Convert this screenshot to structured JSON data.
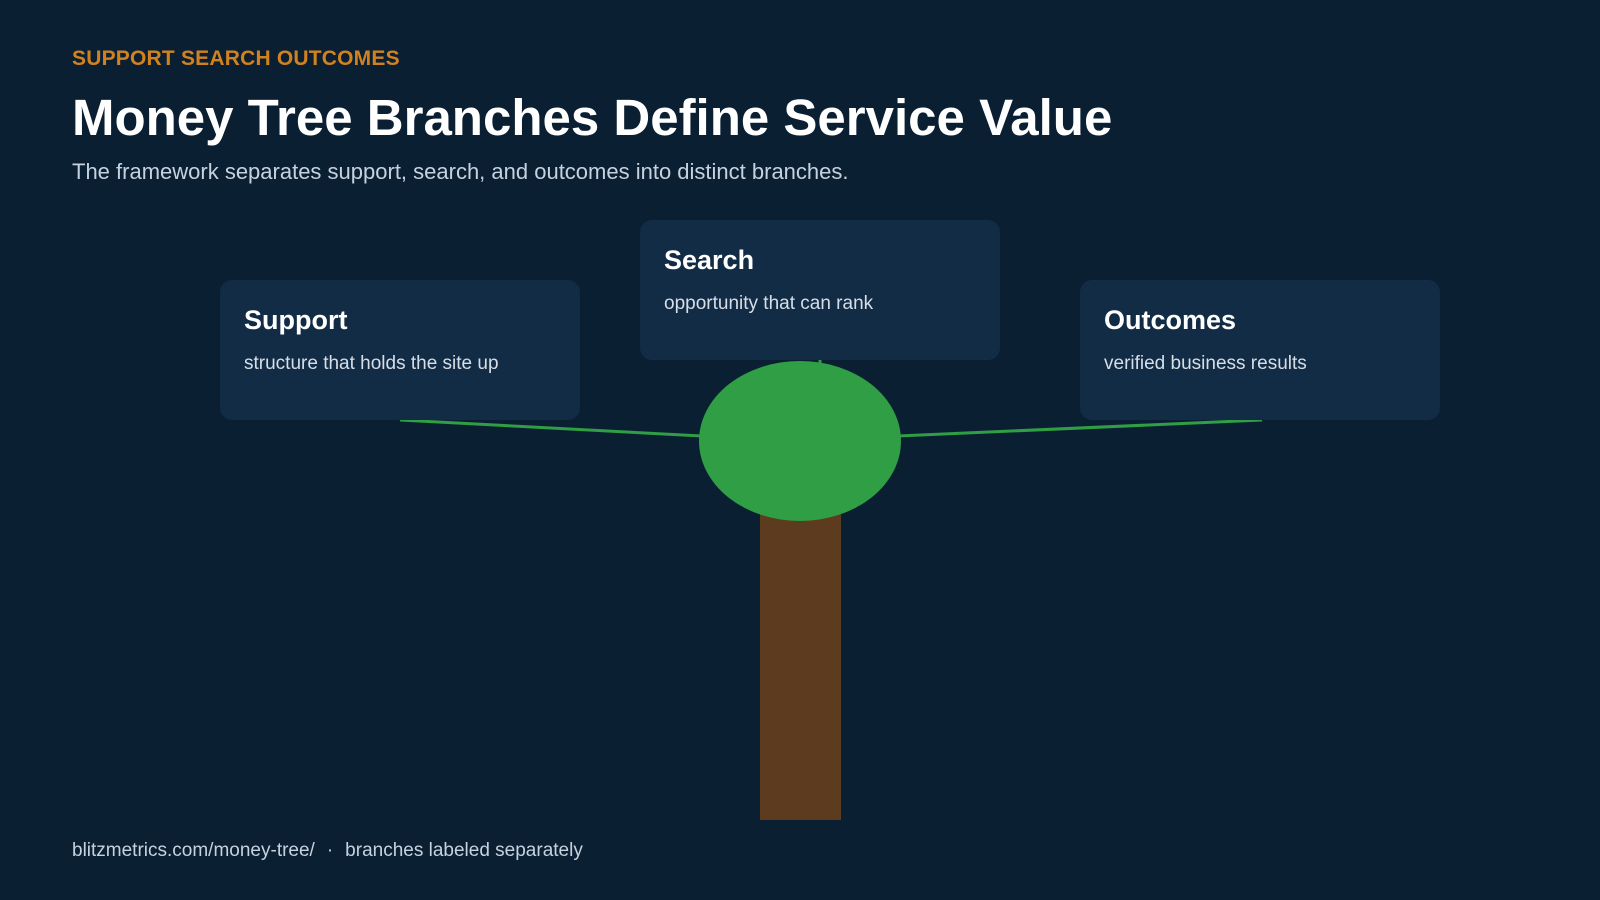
{
  "header": {
    "eyebrow": "SUPPORT SEARCH OUTCOMES",
    "title": "Money Tree Branches Define Service Value",
    "subtitle": "The framework separates support, search, and outcomes into distinct branches."
  },
  "branches": [
    {
      "title": "Support",
      "text": "structure that holds the site up"
    },
    {
      "title": "Search",
      "text": "opportunity that can rank"
    },
    {
      "title": "Outcomes",
      "text": "verified business results"
    }
  ],
  "footer": {
    "source": "blitzmetrics.com/money-tree/",
    "separator": "·",
    "note": "branches labeled separately"
  },
  "colors": {
    "background": "#0b1f33",
    "accent": "#d1821f",
    "card": "#132c45",
    "canopy": "#2f9e44",
    "trunk": "#5c3b1e"
  }
}
